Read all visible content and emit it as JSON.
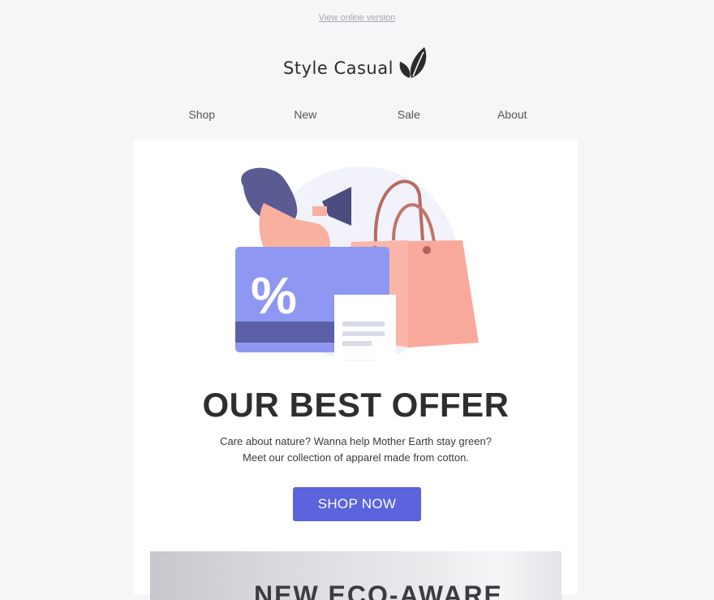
{
  "header": {
    "view_online": "View online version",
    "brand": "Style Casual"
  },
  "nav": {
    "items": [
      {
        "label": "Shop"
      },
      {
        "label": "New"
      },
      {
        "label": "Sale"
      },
      {
        "label": "About"
      }
    ]
  },
  "hero": {
    "illustration": "woman-megaphone-shopping-bag-discount-card",
    "headline": "OUR BEST OFFER",
    "text_line1": "Care about nature? Wanna help Mother Earth stay green?",
    "text_line2": "Meet our collection of apparel made from cotton.",
    "cta_label": "SHOP NOW"
  },
  "banner": {
    "text": "NEW ECO-AWARE"
  },
  "colors": {
    "accent": "#5b64dc",
    "background": "#f6f6f8",
    "card": "#ffffff",
    "bag": "#f8a89c",
    "card_illustration": "#8d97f0"
  }
}
